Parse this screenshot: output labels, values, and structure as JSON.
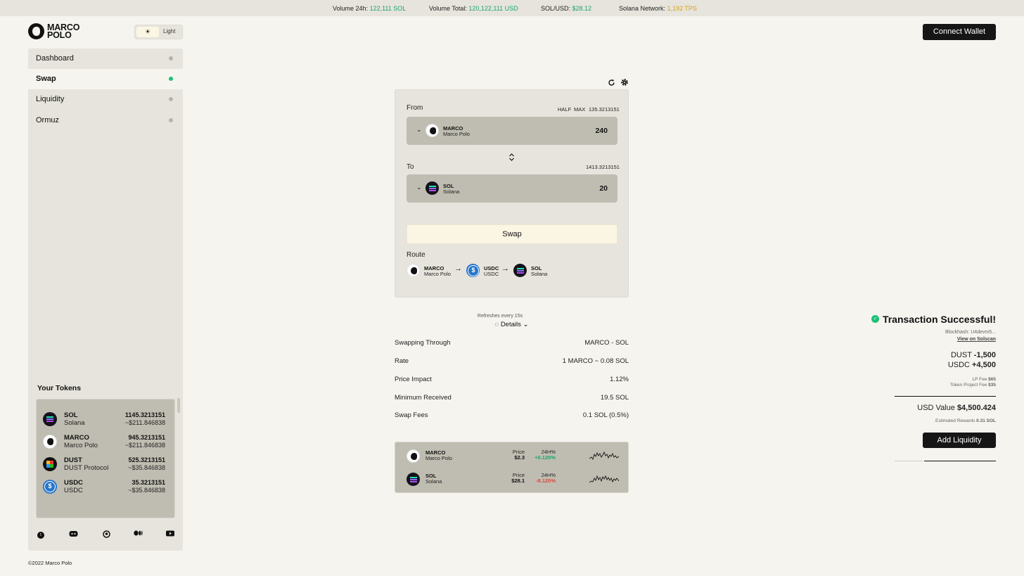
{
  "topbar": {
    "vol24_label": "Volume 24h:",
    "vol24_value": "122,111 SOL",
    "voltotal_label": "Volume Total:",
    "voltotal_value": "120,122,111 USD",
    "solusd_label": "SOL/USD:",
    "solusd_value": "$28.12",
    "network_label": "Solana Network:",
    "network_value": "1,192 TPS"
  },
  "brand": {
    "name_line1": "MARCO",
    "name_line2": "POLO",
    "logo_icon": "marco-polo-head-icon"
  },
  "theme": {
    "label": "Light",
    "icon": "sun-icon"
  },
  "header": {
    "connect_label": "Connect Wallet"
  },
  "sidebar": {
    "items": [
      {
        "label": "Dashboard",
        "active": false
      },
      {
        "label": "Swap",
        "active": true
      },
      {
        "label": "Liquidity",
        "active": false
      },
      {
        "label": "Ormuz",
        "active": false
      }
    ],
    "tokens_title": "Your Tokens",
    "tokens": [
      {
        "symbol": "SOL",
        "name": "Solana",
        "balance": "1145.3213151",
        "usd": "~$211.846838",
        "icon": "solana-icon"
      },
      {
        "symbol": "MARCO",
        "name": "Marco Polo",
        "balance": "945.3213151",
        "usd": "~$211.846838",
        "icon": "marco-icon"
      },
      {
        "symbol": "DUST",
        "name": "DUST Protocol",
        "balance": "525.3213151",
        "usd": "~$35.846838",
        "icon": "dust-icon"
      },
      {
        "symbol": "USDC",
        "name": "USDC",
        "balance": "35.3213151",
        "usd": "~$35.846838",
        "icon": "usdc-icon"
      }
    ],
    "socials": [
      "twitter-icon",
      "discord-icon",
      "github-icon",
      "medium-icon",
      "youtube-icon"
    ]
  },
  "footer": {
    "copyright": "©2022 Marco Polo"
  },
  "swap": {
    "from_label": "From",
    "half_label": "HALF",
    "max_label": "MAX",
    "from_balance": "135.3213151",
    "from_token": {
      "symbol": "MARCO",
      "name": "Marco Polo",
      "amount": "240"
    },
    "to_label": "To",
    "to_balance": "1413.3213151",
    "to_token": {
      "symbol": "SOL",
      "name": "Solana",
      "amount": "20"
    },
    "swap_label": "Swap",
    "route_label": "Route",
    "route": [
      {
        "symbol": "MARCO",
        "name": "Marco Polo"
      },
      {
        "symbol": "USDC",
        "name": "USDC"
      },
      {
        "symbol": "SOL",
        "name": "Solana"
      }
    ],
    "arrow": "→"
  },
  "details": {
    "refresh_note": "Refreshes every 15s",
    "toggle_label": "Details",
    "rows": [
      {
        "label": "Swapping Through",
        "value": "MARCO - SOL"
      },
      {
        "label": "Rate",
        "value": "1 MARCO ~ 0.08 SOL"
      },
      {
        "label": "Price Impact",
        "value": "1.12%"
      },
      {
        "label": "Minimum Received",
        "value": "19.5 SOL"
      },
      {
        "label": "Swap Fees",
        "value": "0.1 SOL (0.5%)"
      }
    ]
  },
  "prices": [
    {
      "symbol": "MARCO",
      "name": "Marco Polo",
      "price_label": "Price",
      "price": "$2.3",
      "change_label": "24H%",
      "change": "+0.120%",
      "change_color": "#1fa36a"
    },
    {
      "symbol": "SOL",
      "name": "Solana",
      "price_label": "Price",
      "price": "$28.1",
      "change_label": "24H%",
      "change": "-8.120%",
      "change_color": "#e0463c"
    }
  ],
  "transaction": {
    "title": "Transaction Successful!",
    "blockhash": "Blockhash: U4devm5...",
    "view_link": "View on Solscan",
    "dust_label": "DUST",
    "dust_value": "-1,500",
    "usdc_label": "USDC",
    "usdc_value": "+4,500",
    "lp_fee_label": "LP Fee",
    "lp_fee_value": "$65",
    "project_fee_label": "Token Project Fee",
    "project_fee_value": "$35",
    "usd_value_label": "USD Value",
    "usd_value": "$4,500.424",
    "rewards_label": "Estimated Rewards",
    "rewards_value": "0.31 SOL",
    "add_liquidity_label": "Add Liquidity"
  }
}
